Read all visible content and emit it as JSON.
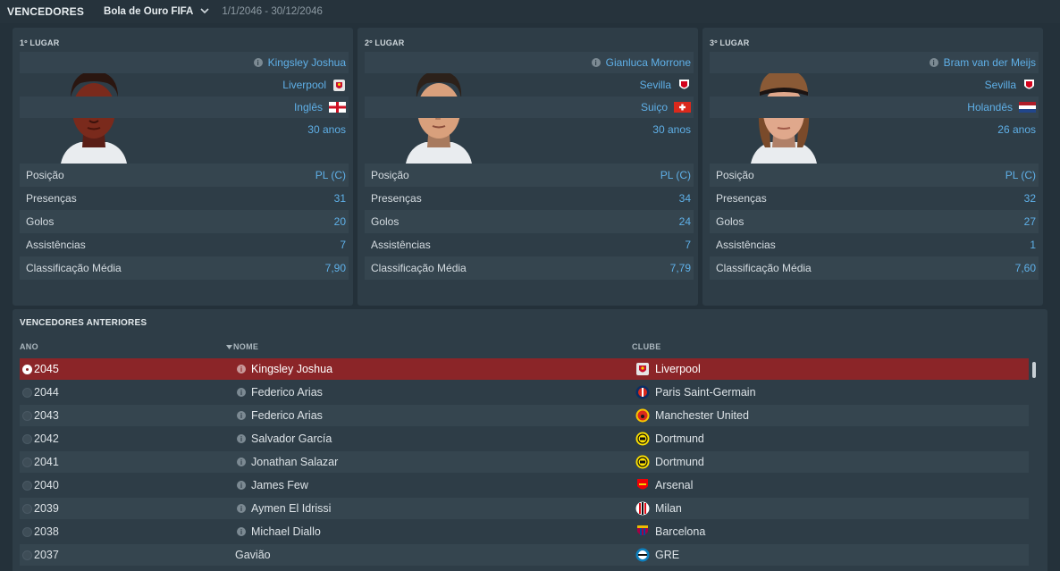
{
  "header": {
    "title": "VENCEDORES",
    "competition": "Bola de Ouro FIFA",
    "dates": "1/1/2046 - 30/12/2046"
  },
  "podium": [
    {
      "place": "1º LUGAR",
      "name": "Kingsley Joshua",
      "club": "Liverpool",
      "nationality": "Inglês",
      "age": "30 anos",
      "stats": [
        {
          "label": "Posição",
          "value": "PL (C)"
        },
        {
          "label": "Presenças",
          "value": "31"
        },
        {
          "label": "Golos",
          "value": "20"
        },
        {
          "label": "Assistências",
          "value": "7"
        },
        {
          "label": "Classificação Média",
          "value": "7,90"
        }
      ]
    },
    {
      "place": "2º LUGAR",
      "name": "Gianluca Morrone",
      "club": "Sevilla",
      "nationality": "Suiço",
      "age": "30 anos",
      "stats": [
        {
          "label": "Posição",
          "value": "PL (C)"
        },
        {
          "label": "Presenças",
          "value": "34"
        },
        {
          "label": "Golos",
          "value": "24"
        },
        {
          "label": "Assistências",
          "value": "7"
        },
        {
          "label": "Classificação Média",
          "value": "7,79"
        }
      ]
    },
    {
      "place": "3º LUGAR",
      "name": "Bram van der Meijs",
      "club": "Sevilla",
      "nationality": "Holandês",
      "age": "26 anos",
      "stats": [
        {
          "label": "Posição",
          "value": "PL (C)"
        },
        {
          "label": "Presenças",
          "value": "32"
        },
        {
          "label": "Golos",
          "value": "27"
        },
        {
          "label": "Assistências",
          "value": "1"
        },
        {
          "label": "Classificação Média",
          "value": "7,60"
        }
      ]
    }
  ],
  "previous": {
    "title": "VENCEDORES ANTERIORES",
    "columns": {
      "year": "ANO",
      "name": "NOME",
      "club": "CLUBE"
    },
    "rows": [
      {
        "year": "2045",
        "name": "Kingsley Joshua",
        "club": "Liverpool"
      },
      {
        "year": "2044",
        "name": "Federico Arias",
        "club": "Paris Saint-Germain"
      },
      {
        "year": "2043",
        "name": "Federico Arias",
        "club": "Manchester United"
      },
      {
        "year": "2042",
        "name": "Salvador García",
        "club": "Dortmund"
      },
      {
        "year": "2041",
        "name": "Jonathan Salazar",
        "club": "Dortmund"
      },
      {
        "year": "2040",
        "name": "James Few",
        "club": "Arsenal"
      },
      {
        "year": "2039",
        "name": "Aymen El Idrissi",
        "club": "Milan"
      },
      {
        "year": "2038",
        "name": "Michael Diallo",
        "club": "Barcelona"
      },
      {
        "year": "2037",
        "name": "Gavião",
        "club": "GRE"
      }
    ]
  },
  "colors": {
    "background": "#24313a",
    "panel": "#2e3d47",
    "accent_blue": "#5fb0e8",
    "selected_row": "#8b2528"
  },
  "icons": {
    "info": "info-icon",
    "dropdown": "chevron-down-icon",
    "sort": "sort-desc-icon"
  }
}
